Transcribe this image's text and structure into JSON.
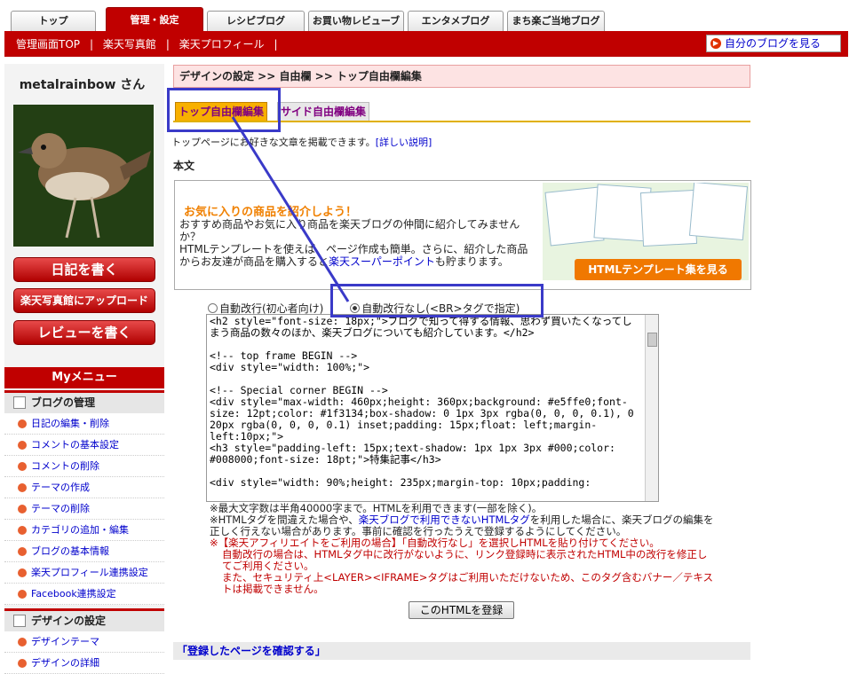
{
  "tabs": [
    "トップ",
    "管理・設定",
    "レシピブログ",
    "お買い物レビューブログ",
    "エンタメブログ",
    "まち楽ご当地ブログ"
  ],
  "sublinks": [
    "管理画面TOP",
    "楽天写真館",
    "楽天プロフィール"
  ],
  "myblog_link": "自分のブログを見る",
  "username": "metalrainbow さん",
  "left_buttons": [
    "日記を書く",
    "楽天写真館にアップロード",
    "レビューを書く"
  ],
  "menu_header": "Myメニュー",
  "section_blog": "ブログの管理",
  "blog_items": [
    "日記の編集・削除",
    "コメントの基本設定",
    "コメントの削除",
    "テーマの作成",
    "テーマの削除",
    "カテゴリの追加・編集",
    "ブログの基本情報",
    "楽天プロフィール連携設定",
    "Facebook連携設定"
  ],
  "section_design": "デザインの設定",
  "design_items": [
    "デザインテーマ",
    "デザインの詳細"
  ],
  "breadcrumb": "デザインの設定 >> 自由欄 >> トップ自由欄編集",
  "subtabs": [
    "トップ自由欄編集",
    "サイド自由欄編集"
  ],
  "description": "トップページにお好きな文章を掲載できます。",
  "description_link": "[詳しい説明]",
  "honbun": "本文",
  "promo": {
    "title": "お気に入りの商品を紹介しよう！",
    "text1": "おすすめ商品やお気に入り商品を楽天ブログの仲間に紹介してみませんか？",
    "text2a": "HTMLテンプレートを使えば、ページ作成も簡単。さらに、紹介した商品からお友達が商品を購入すると",
    "text2link": "楽天スーパーポイント",
    "text2b": "も貯まります。",
    "button": "HTMLテンプレート集を見る"
  },
  "radio_options": [
    "自動改行(初心者向け)",
    "自動改行なし(<BR>タグで指定)"
  ],
  "editor_text": "<h2 style=\"font-size: 18px;\">ブログで知って得する情報、思わず買いたくなってしまう商品の数々のほか、楽天ブログについても紹介しています。</h2>\n\n<!-- top frame BEGIN -->\n<div style=\"width: 100%;\">\n\n<!-- Special corner BEGIN -->\n<div style=\"max-width: 460px;height: 360px;background: #e5ffe0;font-size: 12pt;color: #1f3134;box-shadow: 0 1px 3px rgba(0, 0, 0, 0.1), 0 20px rgba(0, 0, 0, 0.1) inset;padding: 15px;float: left;margin-left:10px;\">\n<h3 style=\"padding-left: 15px;text-shadow: 1px 1px 3px #000;color: #008000;font-size: 18pt;\">特集記事</h3>\n\n<div style=\"width: 90%;height: 235px;margin-top: 10px;padding:",
  "notes": {
    "n1": "※最大文字数は半角40000字まで。HTMLを利用できます(一部を除く)。",
    "n2a": "※HTMLタグを間違えた場合や、",
    "n2link": "楽天ブログで利用できないHTMLタグ",
    "n2b": "を利用した場合に、楽天ブログの編集を正しく行えない場合があります。事前に確認を行ったうえで登録するようにしてください。",
    "n3": "※【楽天アフィリエイトをご利用の場合】「自動改行なし」を選択しHTMLを貼り付けてください。",
    "n4": "自動改行の場合は、HTMLタグ中に改行がないように、リンク登録時に表示されたHTML中の改行を修正してご利用ください。",
    "n5": "また、セキュリティ上<LAYER><IFRAME>タグはご利用いただけないため、このタグ含むバナー／テキストは掲載できません。"
  },
  "submit_label": "このHTMLを登録",
  "confirm_link": "「登録したページを確認する」"
}
